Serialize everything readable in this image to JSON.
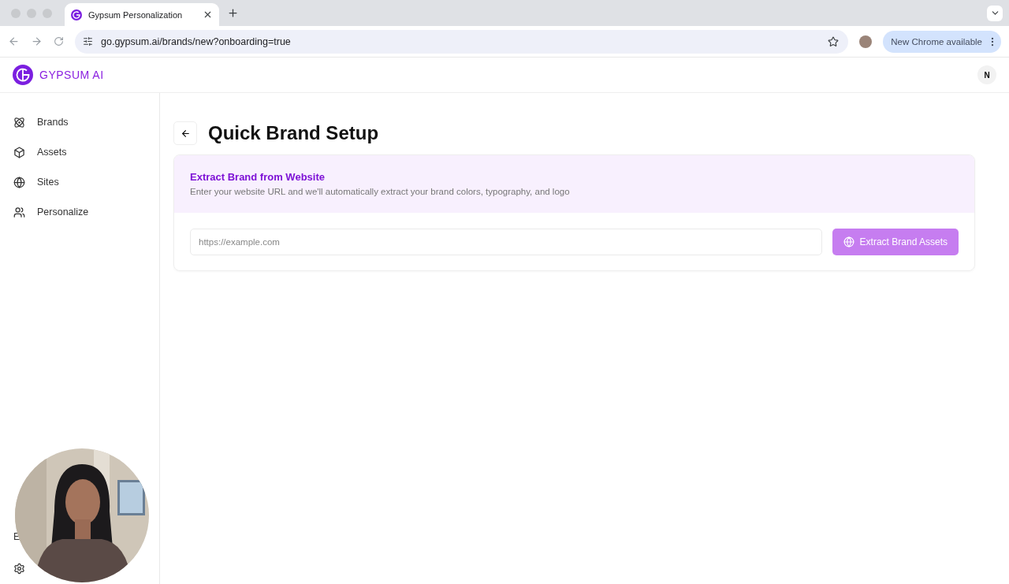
{
  "browser": {
    "tab": {
      "title": "Gypsum Personalization",
      "selected": true
    },
    "address": "go.gypsum.ai/brands/new?onboarding=true",
    "update_chip": "New Chrome available"
  },
  "app": {
    "logo": "GYPSUM AI",
    "avatar": "N"
  },
  "sidebar": {
    "items": [
      {
        "label": "Brands",
        "selected": false
      },
      {
        "label": "Assets",
        "selected": false
      },
      {
        "label": "Sites",
        "selected": false
      },
      {
        "label": "Personalize",
        "selected": false
      }
    ],
    "footer_item": "E"
  },
  "page": {
    "title": "Quick Brand Setup",
    "card": {
      "title": "Extract Brand from Website",
      "description": "Enter your website URL and we'll automatically extract your brand colors, typography, and logo",
      "url_field": {
        "placeholder": "https://example.com"
      },
      "button": {
        "label": "Extract Brand Assets",
        "disabled": true
      }
    }
  }
}
